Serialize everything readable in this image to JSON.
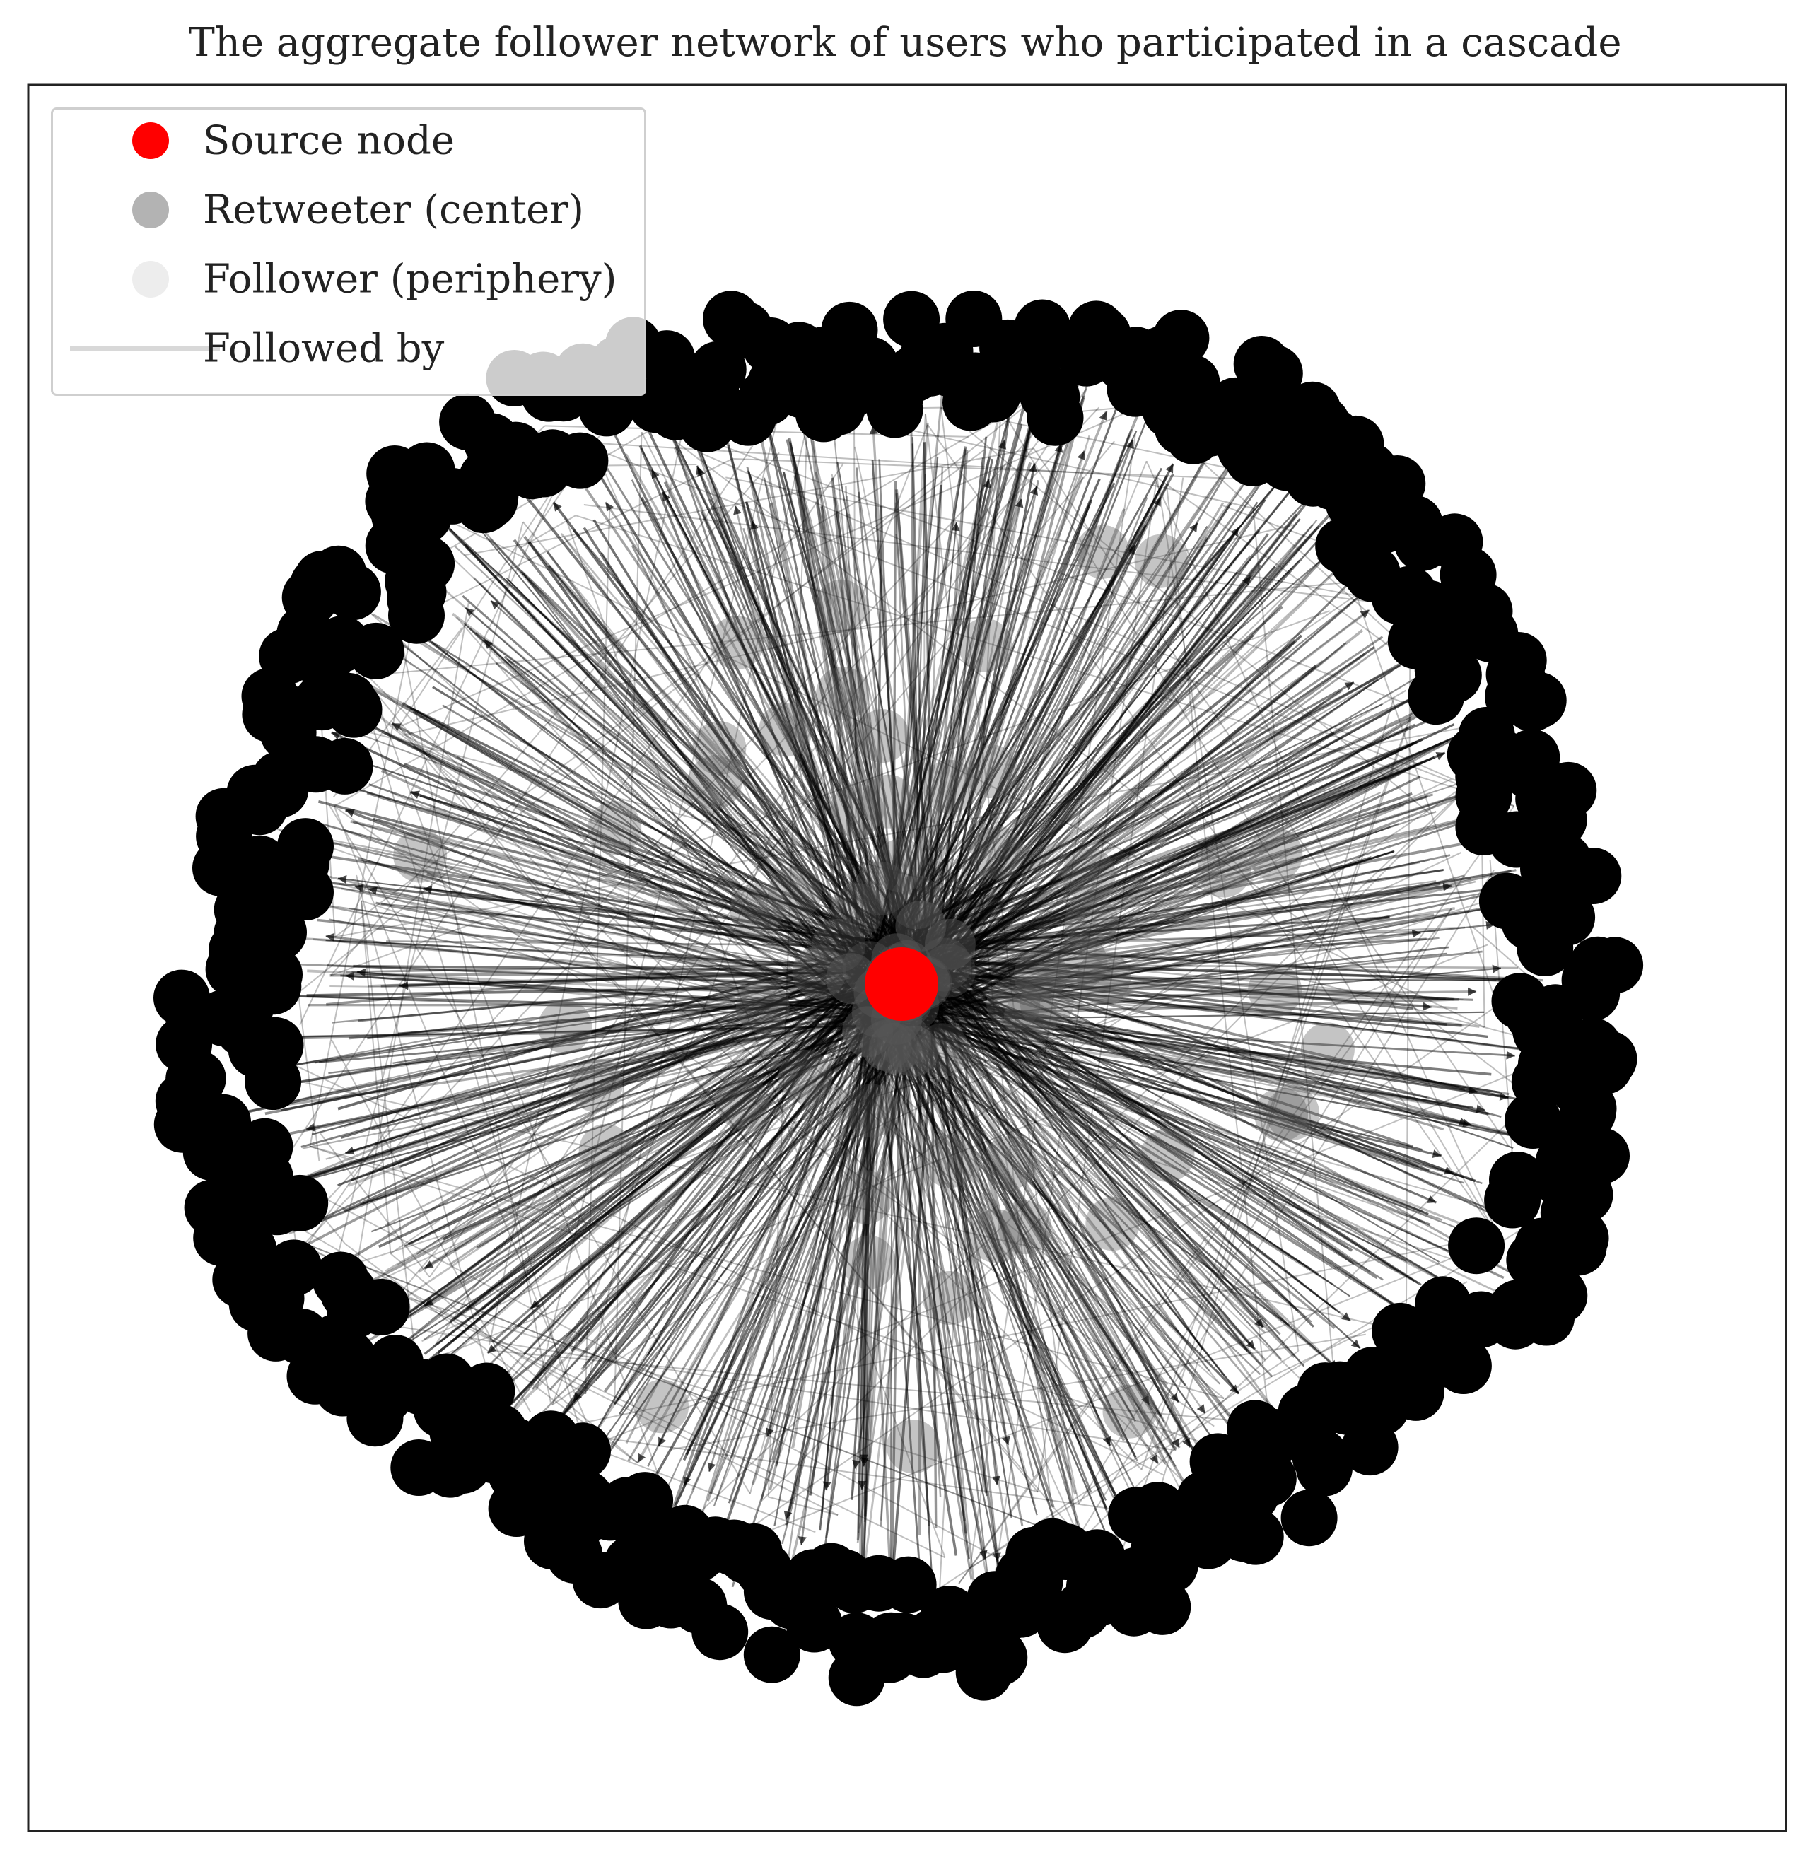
{
  "title": "The aggregate follower network of users who participated in a cascade",
  "legend": [
    {
      "label": "Source node",
      "kind": "marker",
      "color": "#ff0000"
    },
    {
      "label": "Retweeter (center)",
      "kind": "marker",
      "color": "#b3b3b3"
    },
    {
      "label": "Follower (periphery)",
      "kind": "marker",
      "color": "#ededed"
    },
    {
      "label": "Followed by",
      "kind": "line",
      "color": "#d8d8d8"
    }
  ],
  "colors": {
    "source": "#ff0000",
    "retweeter": "#555555",
    "follower": "#000000",
    "edge": "#000000",
    "frame": "#222222"
  }
}
